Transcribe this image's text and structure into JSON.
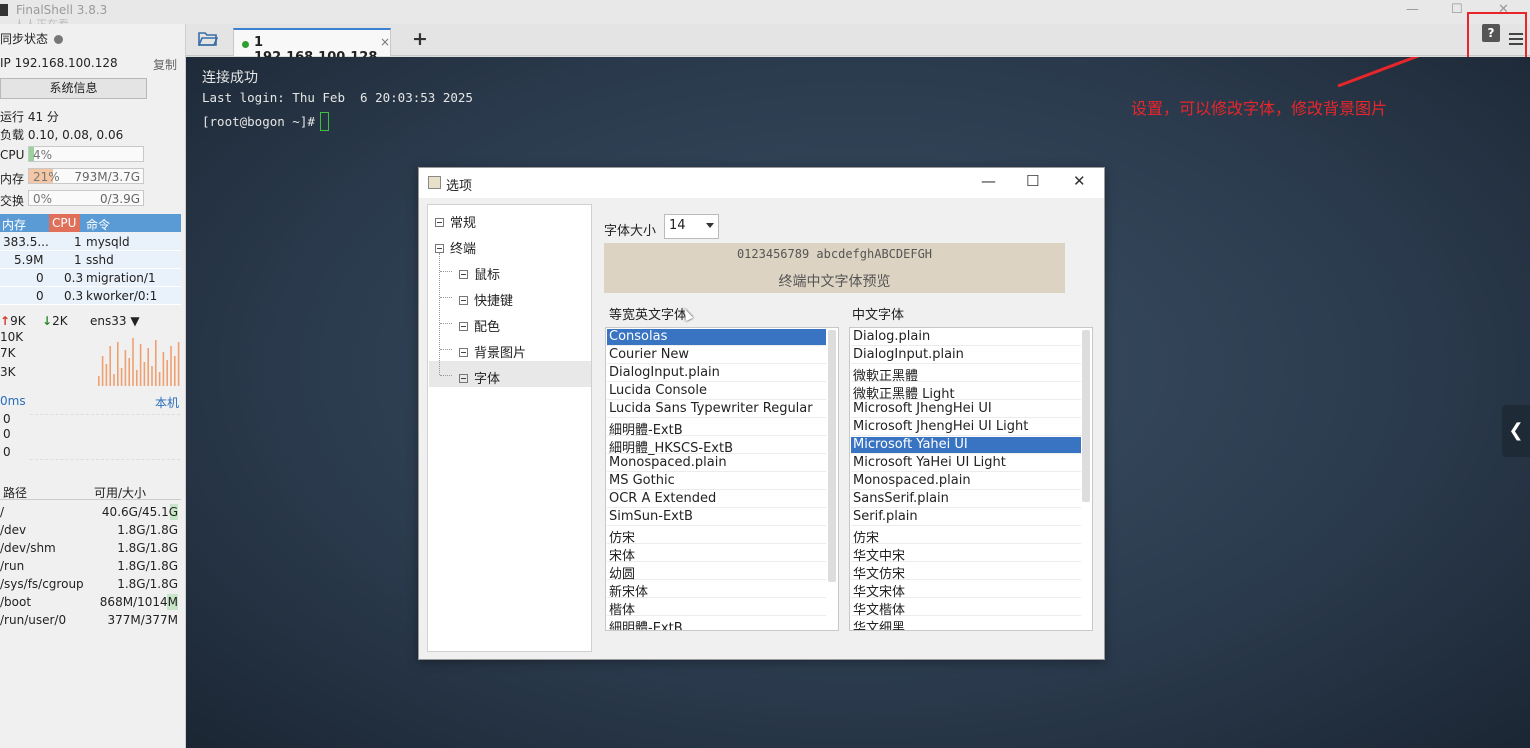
{
  "window": {
    "title": "FinalShell 3.8.3",
    "ghost_text": "人人正在看",
    "controls": [
      "—",
      "☐",
      "✕"
    ]
  },
  "sidebar": {
    "sync_label": "同步状态",
    "ip_label": "IP 192.168.100.128",
    "copy_label": "复制",
    "sysinfo_button": "系统信息",
    "uptime": "运行 41 分",
    "load": "负载 0.10, 0.08, 0.06",
    "cpu": {
      "label": "CPU",
      "pct": "4%",
      "fraction": 0.04
    },
    "mem": {
      "label": "内存",
      "pct": "21%",
      "amount": "793M/3.7G",
      "fraction": 0.21
    },
    "swap": {
      "label": "交换",
      "pct": "0%",
      "amount": "0/3.9G",
      "fraction": 0.0
    },
    "proc_headers": {
      "mem": "内存",
      "cpu": "CPU",
      "cmd": "命令"
    },
    "processes": [
      {
        "mem": "383.5...",
        "cpu": "1",
        "cmd": "mysqld"
      },
      {
        "mem": "5.9M",
        "cpu": "1",
        "cmd": "sshd"
      },
      {
        "mem": "0",
        "cpu": "0.3",
        "cmd": "migration/1"
      },
      {
        "mem": "0",
        "cpu": "0.3",
        "cmd": "kworker/0:1"
      }
    ],
    "net": {
      "up": "9K",
      "down": "2K",
      "iface": "ens33",
      "ticks": [
        "10K",
        "7K",
        "3K"
      ]
    },
    "ping": {
      "label": "0ms",
      "host": "本机",
      "values": [
        "0",
        "0",
        "0"
      ]
    },
    "disk_headers": {
      "path": "路径",
      "size": "可用/大小"
    },
    "disks": [
      {
        "path": "/",
        "size": "40.6G/45.1G",
        "used": 0.1
      },
      {
        "path": "/dev",
        "size": "1.8G/1.8G",
        "used": 0.0
      },
      {
        "path": "/dev/shm",
        "size": "1.8G/1.8G",
        "used": 0.0
      },
      {
        "path": "/run",
        "size": "1.8G/1.8G",
        "used": 0.0
      },
      {
        "path": "/sys/fs/cgroup",
        "size": "1.8G/1.8G",
        "used": 0.0
      },
      {
        "path": "/boot",
        "size": "868M/1014M",
        "used": 0.14
      },
      {
        "path": "/run/user/0",
        "size": "377M/377M",
        "used": 0.0
      }
    ]
  },
  "tabs": {
    "active_label": "1 192.168.100.128",
    "close_glyph": "×",
    "add_glyph": "+",
    "help_glyph": "?"
  },
  "terminal": {
    "lines": [
      "连接成功",
      "Last login: Thu Feb  6 20:03:53 2025",
      "[root@bogon ~]#"
    ]
  },
  "annotation": {
    "text": "设置，可以修改字体，修改背景图片",
    "color": "#e8262a"
  },
  "side_tab_glyph": "❮",
  "dialog": {
    "title": "选项",
    "controls": [
      "—",
      "☐",
      "✕"
    ],
    "tree": [
      {
        "label": "常规"
      },
      {
        "label": "终端"
      },
      {
        "label": "鼠标"
      },
      {
        "label": "快捷键"
      },
      {
        "label": "配色"
      },
      {
        "label": "背景图片"
      },
      {
        "label": "字体"
      }
    ],
    "font_size_label": "字体大小",
    "font_size_value": "14",
    "preview_line1": "0123456789 abcdefghABCDEFGH",
    "preview_line2": "终端中文字体预览",
    "mono_label": "等宽英文字体",
    "cn_label": "中文字体",
    "mono_fonts": [
      "Consolas",
      "Courier New",
      "DialogInput.plain",
      "Lucida Console",
      "Lucida Sans Typewriter Regular",
      "細明體-ExtB",
      "細明體_HKSCS-ExtB",
      "Monospaced.plain",
      "MS Gothic",
      "OCR A Extended",
      "SimSun-ExtB",
      "仿宋",
      "宋体",
      "幼圆",
      "新宋体",
      "楷体",
      "細明體-ExtB"
    ],
    "mono_selected": 0,
    "cn_fonts": [
      "Dialog.plain",
      "DialogInput.plain",
      "微軟正黑體",
      "微軟正黑體 Light",
      "Microsoft JhengHei UI",
      "Microsoft JhengHei UI Light",
      "Microsoft Yahei UI",
      "Microsoft YaHei UI Light",
      "Monospaced.plain",
      "SansSerif.plain",
      "Serif.plain",
      "仿宋",
      "华文中宋",
      "华文仿宋",
      "华文宋体",
      "华文楷体",
      "华文细黑"
    ],
    "cn_selected": 6
  }
}
